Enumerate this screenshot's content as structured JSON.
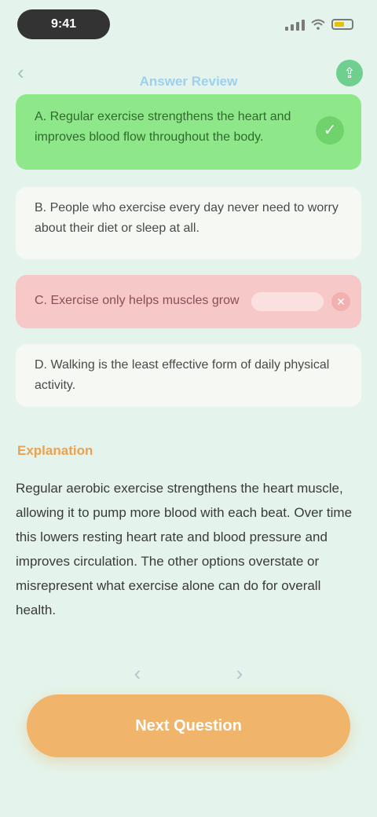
{
  "status": {
    "time": "9:41",
    "battery_level": 0.6,
    "battery_color": "#e6c200"
  },
  "nav": {
    "title": "Answer Review",
    "back_icon": "chevron-left-icon",
    "action_icon": "share-icon"
  },
  "options": [
    {
      "text": "A. Regular exercise strengthens the heart and improves blood flow throughout the body.",
      "state": "correct"
    },
    {
      "text": "B. People who exercise every day never need to worry about their diet or sleep at all.",
      "state": "neutral"
    },
    {
      "text": "C. Exercise only helps muscles grow",
      "state": "wrong"
    },
    {
      "text": "D. Walking is the least effective form of daily physical activity.",
      "state": "neutral"
    }
  ],
  "explanation": {
    "label": "Explanation",
    "text": "Regular aerobic exercise strengthens the heart muscle, allowing it to pump more blood with each beat. Over time this lowers resting heart rate and blood pressure and improves circulation. The other options overstate or misrepresent what exercise alone can do for overall health."
  },
  "pager": {
    "prev_icon": "chevron-left-icon",
    "next_icon": "chevron-right-icon"
  },
  "next_button": {
    "label": "Next Question"
  },
  "colors": {
    "background": "#e4f4ec",
    "correct": "#8ee88a",
    "wrong": "#f6c8c8",
    "accent": "#f0b56a",
    "label": "#e8a253"
  }
}
